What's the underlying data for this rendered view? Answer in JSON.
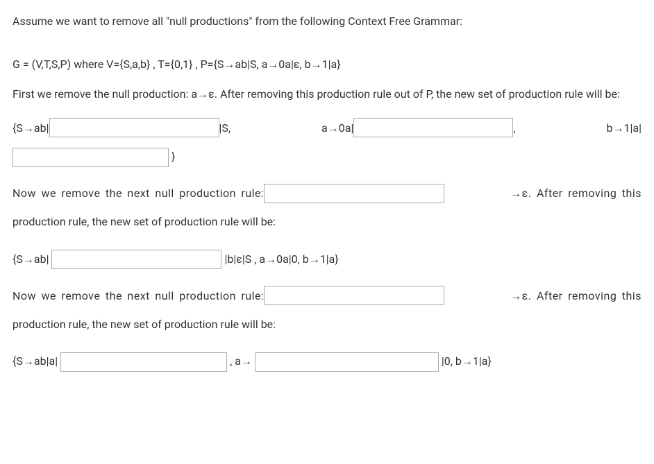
{
  "intro": "Assume we want to remove all \"null productions\" from the following Context Free Grammar:",
  "grammar": "G = (V,T,S,P) where V={S,a,b} , T={0,1} , P={S→ab|S, a→0a|ε, b→1|a}",
  "para1": "First we remove the null production: a→ε. After removing this production rule out of P, the new set of production rule will be:",
  "rule1": {
    "part1_prefix": "{S→ab|",
    "part1_suffix": "|S,",
    "part2_prefix": "a→0a|",
    "part2_suffix": ",",
    "part3_prefix": "b→1|a|",
    "closing": "}"
  },
  "para2_a": "Now we remove the next null production rule: ",
  "para2_b": "→ε. After removing this",
  "para2_c": "production rule, the new set of production rule will be:",
  "rule2": {
    "prefix": "{S→ab|",
    "suffix": "|b|ε|S , a→0a|0, b→1|a}"
  },
  "para3_a": "Now we remove the next null production rule: ",
  "para3_b": "→ε. After removing this",
  "para3_c": "production rule, the new set of production rule will be:",
  "rule3": {
    "prefix": "{S→ab|a|",
    "mid": ", a→",
    "suffix": "|0, b→1|a}"
  }
}
